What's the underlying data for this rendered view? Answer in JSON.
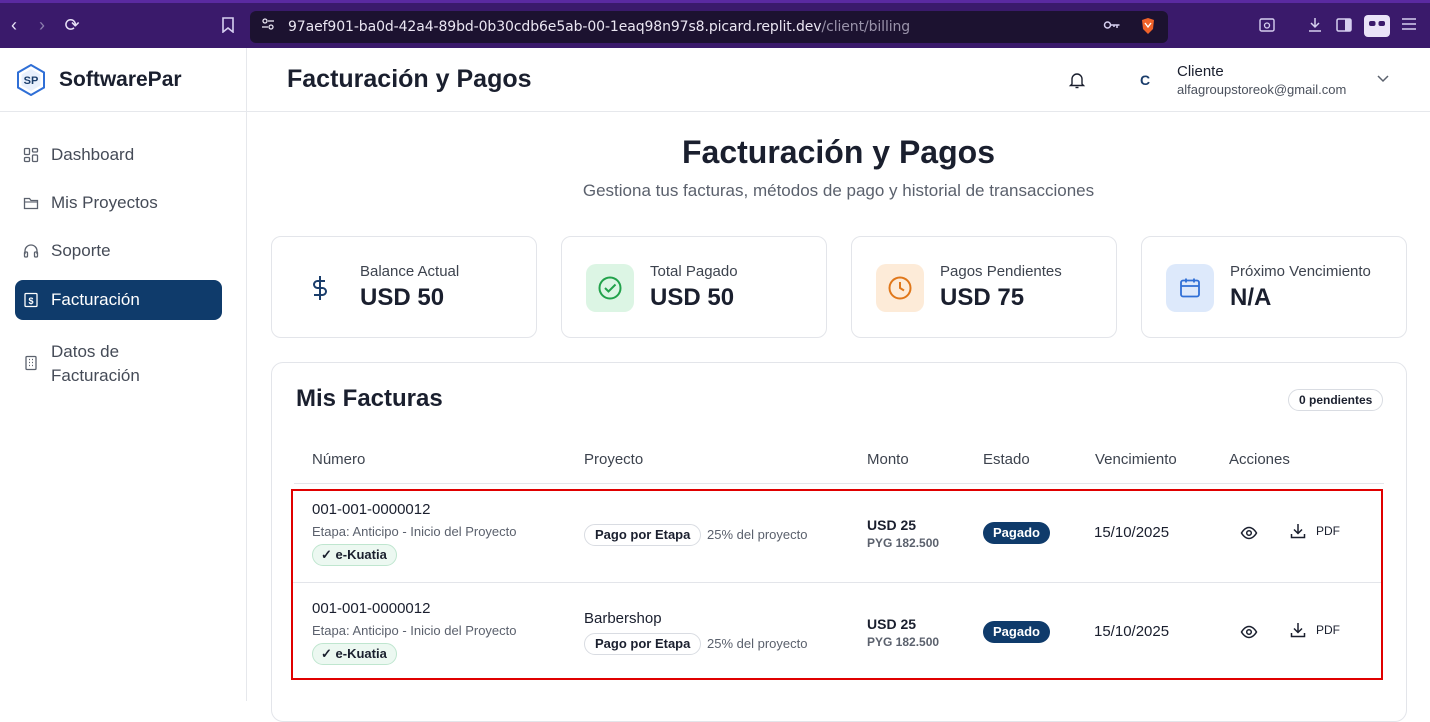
{
  "browser": {
    "url_main": "97aef901-ba0d-42a4-89bd-0b30cdb6e5ab-00-1eaq98n97s8.picard.replit.dev",
    "url_path": "/client/billing"
  },
  "brand": {
    "name": "SoftwarePar"
  },
  "sidebar": {
    "items": [
      {
        "label": "Dashboard",
        "icon": "dashboard-icon"
      },
      {
        "label": "Mis Proyectos",
        "icon": "folder-icon"
      },
      {
        "label": "Soporte",
        "icon": "headphones-icon"
      },
      {
        "label": "Facturación",
        "icon": "invoice-icon",
        "active": true
      },
      {
        "label": "Datos de Facturación",
        "icon": "building-icon"
      }
    ]
  },
  "header": {
    "title": "Facturación y Pagos",
    "avatar_initial": "C",
    "user_name": "Cliente",
    "user_email": "alfagroupstoreok@gmail.com"
  },
  "main": {
    "title": "Facturación y Pagos",
    "subtitle": "Gestiona tus facturas, métodos de pago y historial de transacciones"
  },
  "stats": [
    {
      "label": "Balance Actual",
      "value": "USD 50",
      "icon": "dollar-icon",
      "color": "#1a3d6b",
      "bg": "#ffffff"
    },
    {
      "label": "Total Pagado",
      "value": "USD 50",
      "icon": "check-circle-icon",
      "color": "#22a24b",
      "bg": "#dcf5e4"
    },
    {
      "label": "Pagos Pendientes",
      "value": "USD 75",
      "icon": "clock-icon",
      "color": "#e0771a",
      "bg": "#fdebd8"
    },
    {
      "label": "Próximo Vencimiento",
      "value": "N/A",
      "icon": "calendar-icon",
      "color": "#2f6fd6",
      "bg": "#dde9fb"
    }
  ],
  "invoices": {
    "title": "Mis Facturas",
    "pending_badge": "0 pendientes",
    "columns": [
      "Número",
      "Proyecto",
      "Monto",
      "Estado",
      "Vencimiento",
      "Acciones"
    ],
    "rows": [
      {
        "number": "001-001-0000012",
        "stage": "Etapa: Anticipo - Inicio del Proyecto",
        "ekuatia": "✓ e-Kuatia",
        "project": "",
        "payment_type": "Pago por Etapa",
        "percent": "25% del proyecto",
        "amount_usd": "USD 25",
        "amount_pyg": "PYG 182.500",
        "status": "Pagado",
        "due": "15/10/2025",
        "pdf": "PDF"
      },
      {
        "number": "001-001-0000012",
        "stage": "Etapa: Anticipo - Inicio del Proyecto",
        "ekuatia": "✓ e-Kuatia",
        "project": "Barbershop",
        "payment_type": "Pago por Etapa",
        "percent": "25% del proyecto",
        "amount_usd": "USD 25",
        "amount_pyg": "PYG 182.500",
        "status": "Pagado",
        "due": "15/10/2025",
        "pdf": "PDF"
      }
    ]
  }
}
